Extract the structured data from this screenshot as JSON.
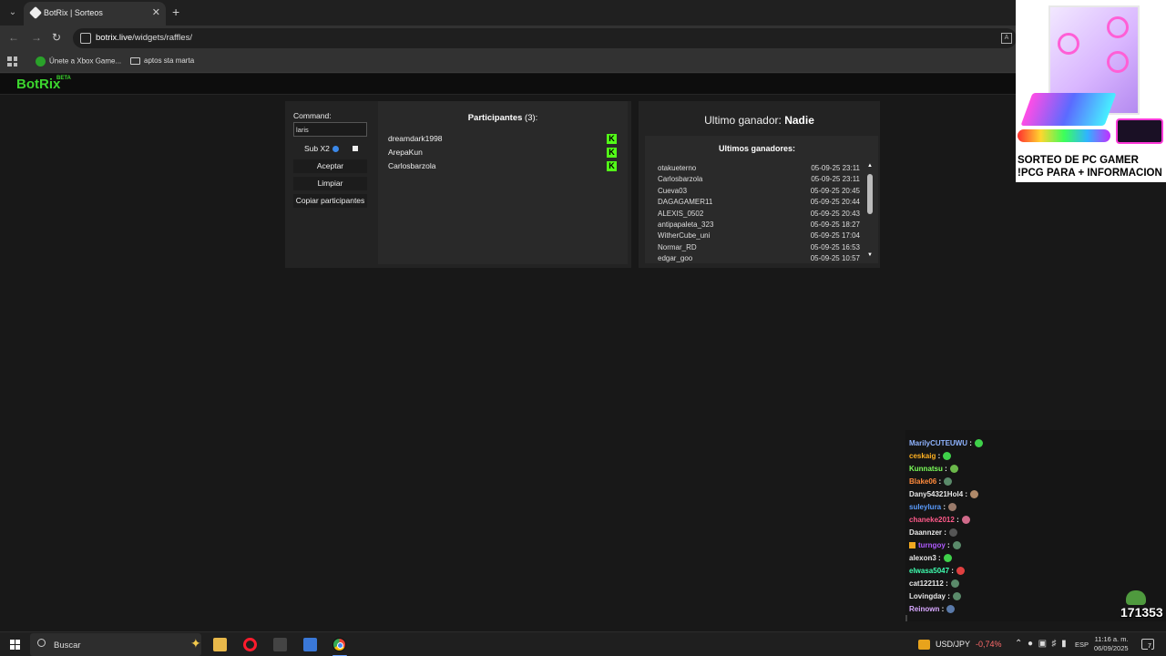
{
  "browser": {
    "tab_title": "BotRix | Sorteos",
    "url_host": "botrix.live",
    "url_path": "/widgets/raffles/",
    "bookmarks": [
      "Únete a Xbox Game...",
      "aptos sta marta"
    ]
  },
  "header": {
    "logo": "BotRix",
    "beta": "BETA"
  },
  "raffle": {
    "command_label": "Command:",
    "command_value": "laris",
    "sub_label": "Sub X2",
    "accept_label": "Aceptar",
    "clear_label": "Limpiar",
    "copy_label": "Copiar participantes",
    "participants_title": "Participantes",
    "participants_count": "(3):",
    "participants": [
      "dreamdark1998",
      "ArepaKun",
      "Carlosbarzola"
    ],
    "kick_icon": "K",
    "last_winner_label": "Ultimo ganador:",
    "last_winner_value": "Nadie",
    "winners_title": "Ultimos ganadores:",
    "winners": [
      {
        "name": "otakueterno",
        "date": "05-09-25 23:11"
      },
      {
        "name": "Carlosbarzola",
        "date": "05-09-25 23:11"
      },
      {
        "name": "Cueva03",
        "date": "05-09-25 20:45"
      },
      {
        "name": "DAGAGAMER11",
        "date": "05-09-25 20:44"
      },
      {
        "name": "ALEXIS_0502",
        "date": "05-09-25 20:43"
      },
      {
        "name": "antipapaleta_323",
        "date": "05-09-25 18:27"
      },
      {
        "name": "WitherCube_uni",
        "date": "05-09-25 17:04"
      },
      {
        "name": "Normar_RD",
        "date": "05-09-25 16:53"
      },
      {
        "name": "edgar_goo",
        "date": "05-09-25 10:57"
      }
    ]
  },
  "promo": {
    "line1": "SORTEO DE PC GAMER",
    "line2": "!PCG PARA + INFORMACION"
  },
  "chat": {
    "messages": [
      {
        "user": "MarilyCUTEUWU",
        "color": "#8fb3ff",
        "emote": "#3fd14a"
      },
      {
        "user": "ceskaig",
        "color": "#ffb020",
        "emote": "#3fd14a"
      },
      {
        "user": "Kunnatsu",
        "color": "#7dff5a",
        "emote": "#6bb84a"
      },
      {
        "user": "Blake06",
        "color": "#ff8a3c",
        "emote": "#5a8a6a"
      },
      {
        "user": "Dany54321Hol4",
        "color": "#e8e8e8",
        "emote": "#b08a6a"
      },
      {
        "user": "suleylura",
        "color": "#5a9cff",
        "emote": "#9a7a6a"
      },
      {
        "user": "chaneke2012",
        "color": "#ff5a8a",
        "emote": "#d06a8a"
      },
      {
        "user": "Daannzer",
        "color": "#e8e8e8",
        "emote": "#555555"
      },
      {
        "user": "turngoy",
        "color": "#b05aff",
        "emote": "#5a8a6a"
      },
      {
        "user": "alexon3",
        "color": "#e8e8e8",
        "emote": "#3fd14a"
      },
      {
        "user": "elwasa5047",
        "color": "#3fffb0",
        "emote": "#e04040"
      },
      {
        "user": "cat122112",
        "color": "#e8e8e8",
        "emote": "#5a8a6a"
      },
      {
        "user": "Lovingday",
        "color": "#e8e8e8",
        "emote": "#5a8a6a"
      },
      {
        "user": "Reinown",
        "color": "#d8a8ff",
        "emote": "#5a7aaa"
      }
    ],
    "separator": ":",
    "viewer_count": "171353"
  },
  "taskbar": {
    "search_placeholder": "Buscar",
    "ticker_symbol": "USD/JPY",
    "ticker_change": "-0,74%",
    "language": "ESP",
    "time": "11:16 a. m.",
    "date": "06/09/2025",
    "notification_count": "7"
  }
}
